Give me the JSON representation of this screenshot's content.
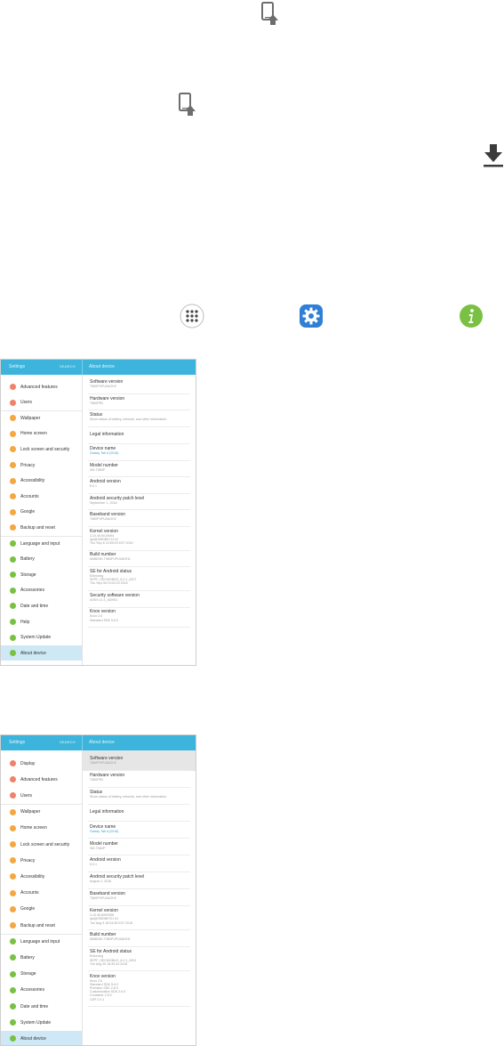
{
  "icons": {
    "update_icon_1": "phone-update-icon",
    "update_icon_2": "phone-update-icon",
    "download_icon": "download-icon",
    "apps_icon": "apps-icon",
    "settings_icon": "settings-gear-icon",
    "info_icon": "info-icon"
  },
  "colors": {
    "header": "#3cb4dc",
    "active_item": "#cfe8f5",
    "settings_icon_bg": "#2f7fd6",
    "info_icon_bg": "#7ac143"
  },
  "screen1": {
    "header": {
      "title": "Settings",
      "search": "SEARCH",
      "detail_title": "About device"
    },
    "left_items": [
      {
        "label": "Advanced features",
        "color": "#f0826a"
      },
      {
        "label": "Users",
        "color": "#f0826a"
      },
      {
        "label": "Wallpaper",
        "color": "#f4a742"
      },
      {
        "label": "Home screen",
        "color": "#f4a742"
      },
      {
        "label": "Lock screen and security",
        "color": "#f4a742"
      },
      {
        "label": "Privacy",
        "color": "#f4a742"
      },
      {
        "label": "Accessibility",
        "color": "#f4a742"
      },
      {
        "label": "Accounts",
        "color": "#f4a742"
      },
      {
        "label": "Google",
        "color": "#f4a742"
      },
      {
        "label": "Backup and reset",
        "color": "#f4a742"
      },
      {
        "label": "Language and input",
        "color": "#7ac143"
      },
      {
        "label": "Battery",
        "color": "#7ac143"
      },
      {
        "label": "Storage",
        "color": "#7ac143"
      },
      {
        "label": "Accessories",
        "color": "#7ac143"
      },
      {
        "label": "Date and time",
        "color": "#7ac143"
      },
      {
        "label": "Help",
        "color": "#7ac143"
      },
      {
        "label": "System Update",
        "color": "#7ac143"
      },
      {
        "label": "About device",
        "color": "#7ac143"
      }
    ],
    "right_items": [
      {
        "title": "Software version",
        "sub": [
          "T560PVPU0AOH2"
        ]
      },
      {
        "title": "Hardware version",
        "sub": [
          "T560PR2"
        ]
      },
      {
        "title": "Status",
        "sub": [
          "Show status of battery, network, and other information."
        ]
      },
      {
        "title": "Legal information",
        "sub": []
      },
      {
        "title": "Device name",
        "sub": [
          "Galaxy Tab A (2016)"
        ]
      },
      {
        "title": "Model number",
        "sub": [
          "SM-T560P"
        ]
      },
      {
        "title": "Android version",
        "sub": [
          "6.0.1"
        ]
      },
      {
        "title": "Android security patch level",
        "sub": [
          "September 1, 2016"
        ]
      },
      {
        "title": "Baseband version",
        "sub": [
          "T560PVPU0AOH2"
        ]
      },
      {
        "title": "Kernel version",
        "sub": [
          "3.10.49-9019094",
          "dpi@SWDB9713 #1",
          "Thu Sep 8 19:55:03 KST 2016"
        ]
      },
      {
        "title": "Build number",
        "sub": [
          "MMB29K.T560PVPU0AOH2"
        ]
      },
      {
        "title": "SE for Android status",
        "sub": [
          "Enforcing",
          "SEPF_SECMOBILE_6.0.1_0027",
          "Thu Sep 08 19:00:23 2016"
        ]
      },
      {
        "title": "Security software version",
        "sub": [
          "ASKS v1.3_160901"
        ]
      },
      {
        "title": "Knox version",
        "sub": [
          "Knox 2.6",
          "Standard SDK 5.6.0"
        ]
      }
    ]
  },
  "screen2": {
    "header": {
      "title": "Settings",
      "search": "SEARCH",
      "detail_title": "About device"
    },
    "left_items": [
      {
        "label": "Display",
        "color": "#f0826a"
      },
      {
        "label": "Advanced features",
        "color": "#f0826a"
      },
      {
        "label": "Users",
        "color": "#f0826a"
      },
      {
        "label": "Wallpaper",
        "color": "#f4a742"
      },
      {
        "label": "Home screen",
        "color": "#f4a742"
      },
      {
        "label": "Lock screen and security",
        "color": "#f4a742"
      },
      {
        "label": "Privacy",
        "color": "#f4a742"
      },
      {
        "label": "Accessibility",
        "color": "#f4a742"
      },
      {
        "label": "Accounts",
        "color": "#f4a742"
      },
      {
        "label": "Google",
        "color": "#f4a742"
      },
      {
        "label": "Backup and reset",
        "color": "#f4a742"
      },
      {
        "label": "Language and input",
        "color": "#7ac143"
      },
      {
        "label": "Battery",
        "color": "#7ac143"
      },
      {
        "label": "Storage",
        "color": "#7ac143"
      },
      {
        "label": "Accessories",
        "color": "#7ac143"
      },
      {
        "label": "Date and time",
        "color": "#7ac143"
      },
      {
        "label": "System Update",
        "color": "#7ac143"
      },
      {
        "label": "About device",
        "color": "#7ac143"
      }
    ],
    "right_items": [
      {
        "title": "Software version",
        "sub": [
          "T560PVPU0AOH2"
        ]
      },
      {
        "title": "Hardware version",
        "sub": [
          "T560PR2"
        ]
      },
      {
        "title": "Status",
        "sub": [
          "Show status of battery, network, and other information."
        ]
      },
      {
        "title": "Legal information",
        "sub": []
      },
      {
        "title": "Device name",
        "sub": [
          "Galaxy Tab A (2016)"
        ]
      },
      {
        "title": "Model number",
        "sub": [
          "SM-T560P"
        ]
      },
      {
        "title": "Android version",
        "sub": [
          "6.0.1"
        ]
      },
      {
        "title": "Android security patch level",
        "sub": [
          "August 1, 2016"
        ]
      },
      {
        "title": "Baseband version",
        "sub": [
          "T560PVPU0AOH2"
        ]
      },
      {
        "title": "Kernel version",
        "sub": [
          "3.10.49-8999396",
          "dpi@SWDB9701 #1",
          "Tue Aug 9 18:34:35 KST 2016"
        ]
      },
      {
        "title": "Build number",
        "sub": [
          "MMB29K.T560PVPU0AOH2"
        ]
      },
      {
        "title": "SE for Android status",
        "sub": [
          "Enforcing",
          "SEPF_SECMOBILE_6.0.1_0001",
          "Tue Aug 09 18:30:44 2016"
        ]
      },
      {
        "title": "Knox version",
        "sub": [
          "Knox 2.6",
          "Standard SDK 5.6.0",
          "Premium SDK 2.6.0",
          "Customization SDK 2.6.0",
          "Container 2.6.0",
          "CEP 2.0.1"
        ]
      }
    ]
  }
}
